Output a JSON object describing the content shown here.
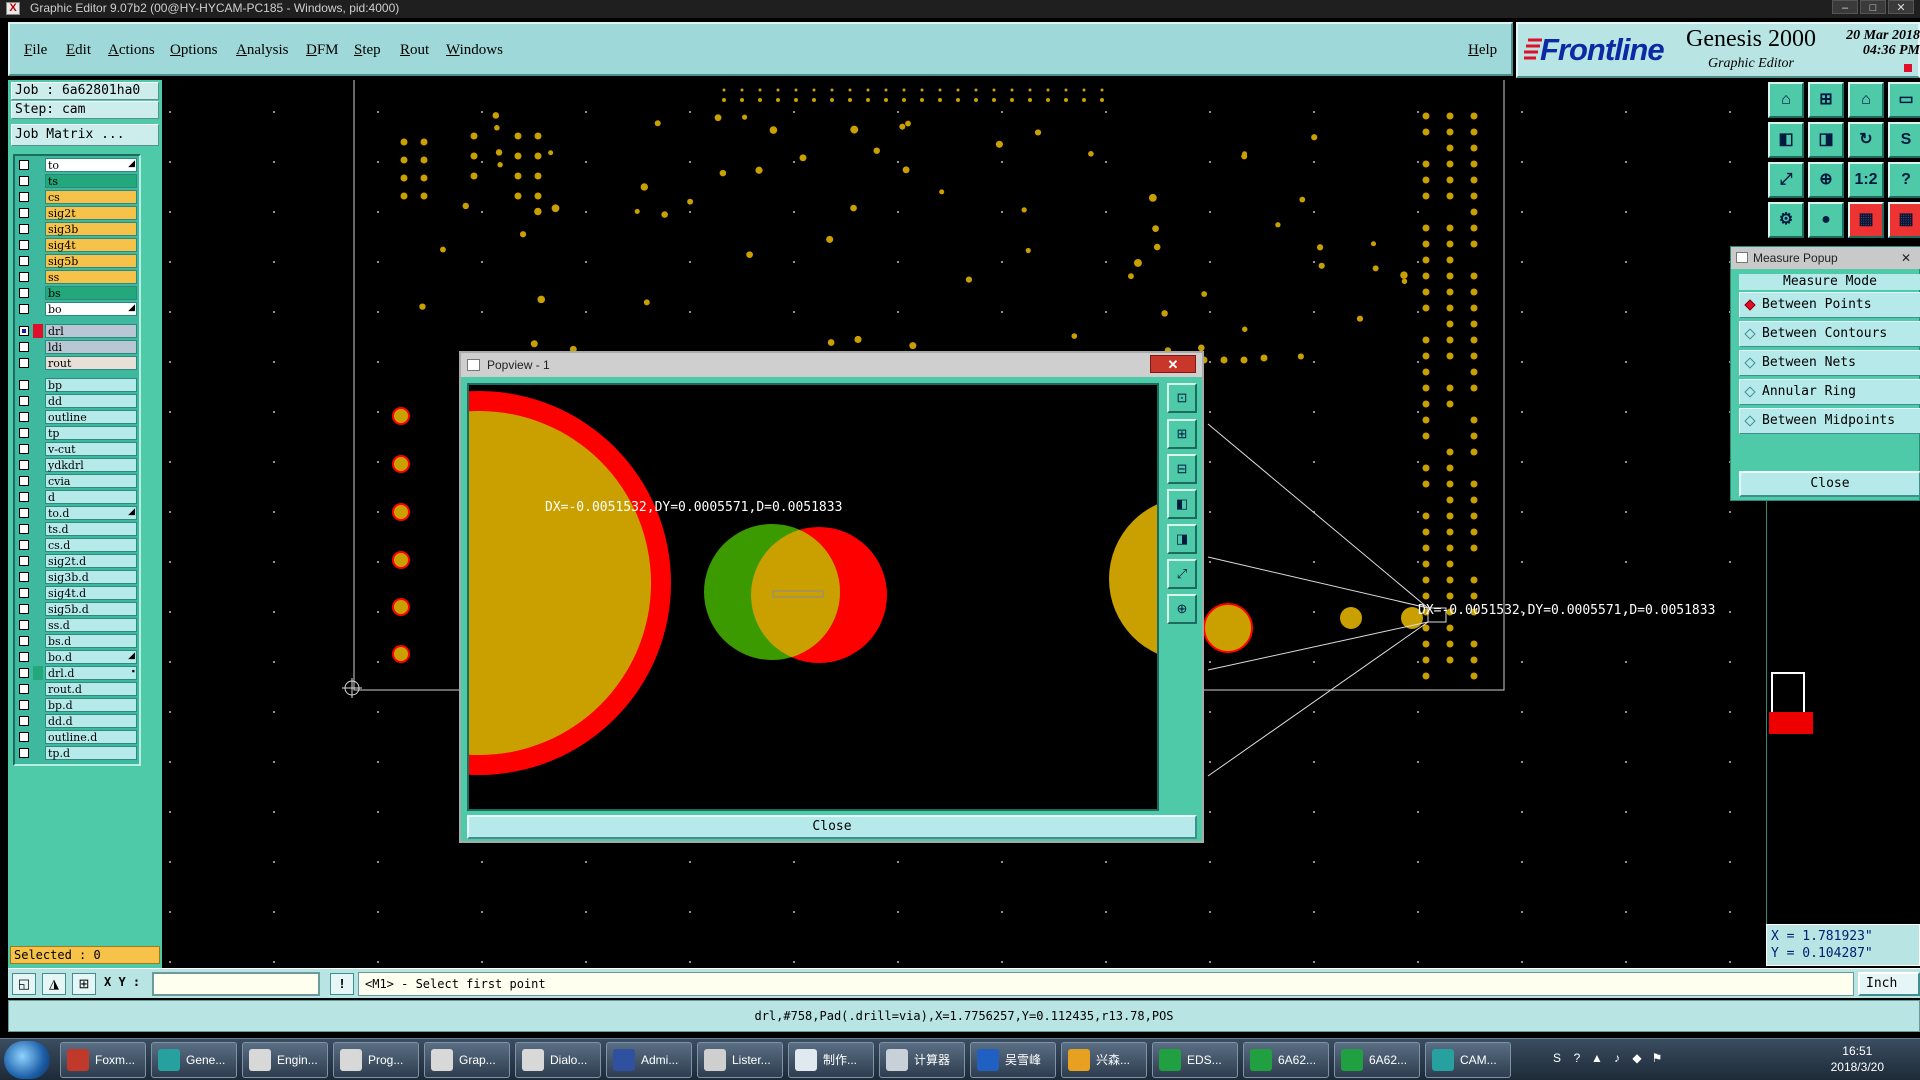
{
  "window": {
    "title": "Graphic Editor 9.07b2 (00@HY-HYCAM-PC185 - Windows, pid:4000)",
    "controls": [
      "–",
      "□",
      "✕"
    ]
  },
  "menu": {
    "items": [
      "File",
      "Edit",
      "Actions",
      "Options",
      "Analysis",
      "DFM",
      "Step",
      "Rout",
      "Windows"
    ],
    "help": "Help"
  },
  "brand": {
    "logo": "Frontline",
    "product": "Genesis 2000",
    "subtitle": "Graphic Editor",
    "date_line1": "20 Mar 2018",
    "date_line2": "04:36 PM"
  },
  "job": {
    "job_label": "Job : 6a62801ha0",
    "step_label": "Step: cam",
    "matrix_button": "Job Matrix ..."
  },
  "layers": [
    {
      "name": "to",
      "color": "#ffffff",
      "mark": "◢"
    },
    {
      "name": "ts",
      "color": "#22a87a",
      "mark": ""
    },
    {
      "name": "cs",
      "color": "#f7c24a",
      "mark": ""
    },
    {
      "name": "sig2t",
      "color": "#f7c24a",
      "mark": ""
    },
    {
      "name": "sig3b",
      "color": "#f7c24a",
      "mark": ""
    },
    {
      "name": "sig4t",
      "color": "#f7c24a",
      "mark": ""
    },
    {
      "name": "sig5b",
      "color": "#f7c24a",
      "mark": ""
    },
    {
      "name": "ss",
      "color": "#f7c24a",
      "mark": ""
    },
    {
      "name": "bs",
      "color": "#22a87a",
      "mark": ""
    },
    {
      "name": "bo",
      "color": "#ffffff",
      "mark": "◢"
    },
    {
      "name": "drl",
      "color": "#b9c6d4",
      "mark": ""
    },
    {
      "name": "ldi",
      "color": "#b9c6d4",
      "mark": ""
    },
    {
      "name": "rout",
      "color": "#e8e0d8",
      "mark": ""
    },
    {
      "name": "bp",
      "color": "#b6eaea",
      "mark": ""
    },
    {
      "name": "dd",
      "color": "#b6eaea",
      "mark": ""
    },
    {
      "name": "outline",
      "color": "#b6eaea",
      "mark": ""
    },
    {
      "name": "tp",
      "color": "#b6eaea",
      "mark": ""
    },
    {
      "name": "v-cut",
      "color": "#b6eaea",
      "mark": ""
    },
    {
      "name": "ydkdrl",
      "color": "#b6eaea",
      "mark": ""
    },
    {
      "name": "cvia",
      "color": "#b6eaea",
      "mark": ""
    },
    {
      "name": "d",
      "color": "#b6eaea",
      "mark": ""
    },
    {
      "name": "to.d",
      "color": "#b6eaea",
      "mark": "◢"
    },
    {
      "name": "ts.d",
      "color": "#b6eaea",
      "mark": ""
    },
    {
      "name": "cs.d",
      "color": "#b6eaea",
      "mark": ""
    },
    {
      "name": "sig2t.d",
      "color": "#b6eaea",
      "mark": ""
    },
    {
      "name": "sig3b.d",
      "color": "#b6eaea",
      "mark": ""
    },
    {
      "name": "sig4t.d",
      "color": "#b6eaea",
      "mark": ""
    },
    {
      "name": "sig5b.d",
      "color": "#b6eaea",
      "mark": ""
    },
    {
      "name": "ss.d",
      "color": "#b6eaea",
      "mark": ""
    },
    {
      "name": "bs.d",
      "color": "#b6eaea",
      "mark": ""
    },
    {
      "name": "bo.d",
      "color": "#b6eaea",
      "mark": "◢"
    },
    {
      "name": "drl.d",
      "color": "#b6eaea",
      "mark": "▪"
    },
    {
      "name": "rout.d",
      "color": "#b6eaea",
      "mark": ""
    },
    {
      "name": "bp.d",
      "color": "#b6eaea",
      "mark": ""
    },
    {
      "name": "dd.d",
      "color": "#b6eaea",
      "mark": ""
    },
    {
      "name": "outline.d",
      "color": "#b6eaea",
      "mark": ""
    },
    {
      "name": "tp.d",
      "color": "#b6eaea",
      "mark": ""
    }
  ],
  "selected": "Selected : 0",
  "canvas": {
    "measure_text": "DX=-0.0051532,DY=0.0005571,D=0.0051833"
  },
  "popview": {
    "title": "Popview - 1",
    "measure_text": "DX=-0.0051532,DY=0.0005571,D=0.0051833",
    "close": "Close",
    "close_x": "✕"
  },
  "measure_popup": {
    "title": "Measure Popup",
    "heading": "Measure Mode",
    "options": [
      {
        "label": "Between Points",
        "selected": true
      },
      {
        "label": "Between Contours",
        "selected": false
      },
      {
        "label": "Between Nets",
        "selected": false
      },
      {
        "label": "Annular Ring",
        "selected": false
      },
      {
        "label": "Between Midpoints",
        "selected": false
      }
    ],
    "close": "Close"
  },
  "coords": {
    "x": "X = 1.781923\"",
    "y": "Y = 0.104287\""
  },
  "command": {
    "xy_label": "X Y :",
    "xy_value": "",
    "bang": "!",
    "prompt": "<M1> - Select first point",
    "units": "Inch"
  },
  "status_line": "drl,#758,Pad(.drill=via),X=1.7756257,Y=0.112435,r13.78,POS",
  "taskbar": {
    "tasks": [
      {
        "label": "Foxm...",
        "color": "#c0392b"
      },
      {
        "label": "Gene...",
        "color": "#27a0a0"
      },
      {
        "label": "Engin...",
        "color": "#d8d8d8"
      },
      {
        "label": "Prog...",
        "color": "#d8d8d8"
      },
      {
        "label": "Grap...",
        "color": "#d8d8d8"
      },
      {
        "label": "Dialo...",
        "color": "#d8d8d8"
      },
      {
        "label": "Admi...",
        "color": "#3050a0"
      },
      {
        "label": "Lister...",
        "color": "#cfcfcf"
      },
      {
        "label": "制作...",
        "color": "#e0e8f0"
      },
      {
        "label": "计算器",
        "color": "#c8d0d8"
      },
      {
        "label": "吴雪峰",
        "color": "#2060c0"
      },
      {
        "label": "兴森...",
        "color": "#e8a020"
      },
      {
        "label": "EDS...",
        "color": "#20a040"
      },
      {
        "label": "6A62...",
        "color": "#20a040"
      },
      {
        "label": "6A62...",
        "color": "#20a040"
      },
      {
        "label": "CAM...",
        "color": "#27a0a0"
      }
    ],
    "time": "16:51",
    "date": "2018/3/20"
  },
  "colors": {
    "pad": "#c9a000",
    "highlight": "#ff0000",
    "green": "#3b9a00"
  }
}
